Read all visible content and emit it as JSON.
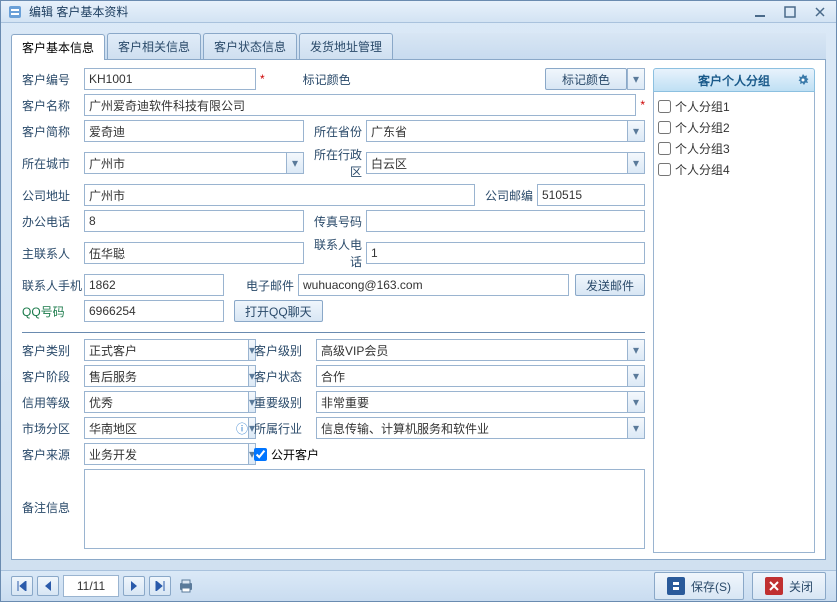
{
  "window": {
    "title": "编辑 客户基本资料"
  },
  "tabs": [
    "客户基本信息",
    "客户相关信息",
    "客户状态信息",
    "发货地址管理"
  ],
  "labels": {
    "customer_no": "客户编号",
    "mark_color": "标记颜色",
    "mark_color_btn": "标记颜色",
    "customer_name": "客户名称",
    "short_name": "客户简称",
    "province": "所在省份",
    "city": "所在城市",
    "district": "所在行政区",
    "address": "公司地址",
    "zip": "公司邮编",
    "office_tel": "办公电话",
    "fax": "传真号码",
    "main_contact": "主联系人",
    "contact_tel": "联系人电话",
    "contact_mobile": "联系人手机",
    "email": "电子邮件",
    "send_mail": "发送邮件",
    "qq": "QQ号码",
    "open_qq": "打开QQ聊天",
    "cust_type": "客户类别",
    "cust_level": "客户级别",
    "cust_stage": "客户阶段",
    "cust_status": "客户状态",
    "credit": "信用等级",
    "importance": "重要级别",
    "market": "市场分区",
    "industry": "所属行业",
    "source": "客户来源",
    "public": "公开客户",
    "remark": "备注信息"
  },
  "values": {
    "customer_no": "KH1001",
    "customer_name": "广州爱奇迪软件科技有限公司",
    "short_name": "爱奇迪",
    "province": "广东省",
    "city": "广州市",
    "district": "白云区",
    "address": "广州市",
    "zip": "510515",
    "office_tel": "8",
    "fax": "",
    "main_contact": "伍华聪",
    "contact_tel": "1",
    "contact_mobile": "1862",
    "email": "wuhuacong@163.com",
    "qq": "6966254",
    "cust_type": "正式客户",
    "cust_level": "高级VIP会员",
    "cust_stage": "售后服务",
    "cust_status": "合作",
    "credit": "优秀",
    "importance": "非常重要",
    "market": "华南地区",
    "industry": "信息传输、计算机服务和软件业",
    "source": "业务开发",
    "remark": ""
  },
  "side": {
    "title": "客户个人分组",
    "items": [
      "个人分组1",
      "个人分组2",
      "个人分组3",
      "个人分组4"
    ]
  },
  "footer": {
    "page": "11/11",
    "save": "保存(S)",
    "close": "关闭"
  }
}
